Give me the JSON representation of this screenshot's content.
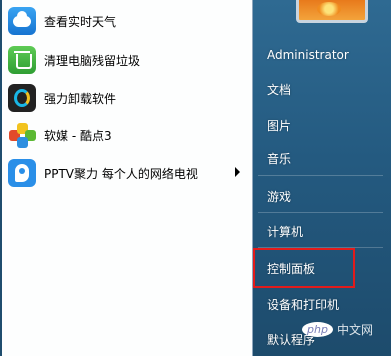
{
  "programs": [
    {
      "label": "查看实时天气",
      "icon": "weather-icon"
    },
    {
      "label": "清理电脑残留垃圾",
      "icon": "recycle-bin-icon"
    },
    {
      "label": "强力卸载软件",
      "icon": "uninstall-icon"
    },
    {
      "label": "软媒 - 酷点3",
      "icon": "ruanmei-icon"
    },
    {
      "label": "PPTV聚力 每个人的网络电视",
      "icon": "pptv-icon",
      "has_submenu": true
    }
  ],
  "user": {
    "name": "Administrator"
  },
  "right_items": [
    "文档",
    "图片",
    "音乐",
    "游戏",
    "计算机",
    "控制面板",
    "设备和打印机",
    "默认程序"
  ],
  "watermark": {
    "logo": "php",
    "text": "中文网"
  },
  "colors": {
    "highlight": "#e21b1b",
    "right_pane": "#245a80"
  }
}
